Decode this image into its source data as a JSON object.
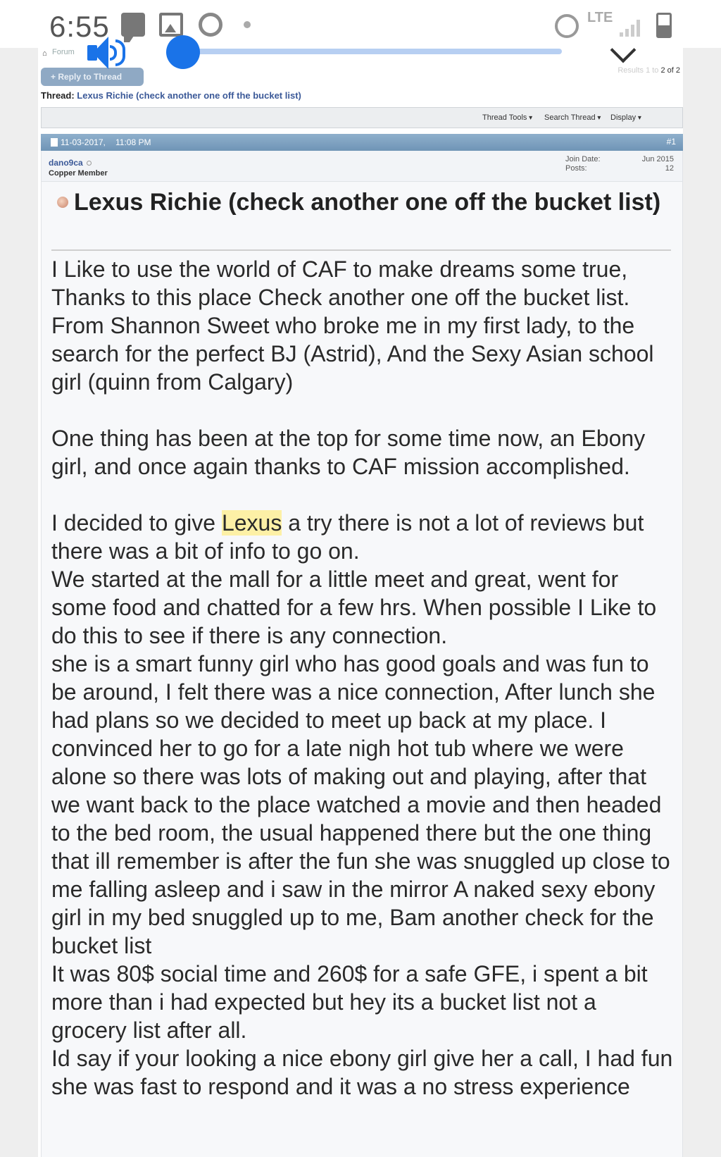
{
  "status_bar": {
    "time": "6:55",
    "network": "LTE"
  },
  "forum": {
    "breadcrumb": "Forum",
    "reply_button": "+ Reply to Thread",
    "results_prefix": "Results 1 to ",
    "results_suffix": "2 of 2",
    "thread_label": "Thread:",
    "thread_title": "Lexus Richie (check another one off the bucket list)",
    "tools": [
      "Thread Tools",
      "Search Thread",
      "Display"
    ]
  },
  "post": {
    "date": "11-03-2017,",
    "time": "11:08 PM",
    "number": "#1",
    "username": "dano9ca",
    "user_title": "Copper Member",
    "join_date_label": "Join Date:",
    "join_date": "Jun 2015",
    "posts_label": "Posts:",
    "posts": "12",
    "title": "Lexus Richie (check another one off the bucket list)",
    "p1": "I Like to use the world of CAF to make dreams some true, Thanks to this place Check another one off the bucket list. From Shannon Sweet who broke me in my first lady, to the search for the perfect BJ (Astrid), And the Sexy Asian school girl (quinn from Calgary)",
    "p2": "One thing has been at the top for some time now, an Ebony girl, and once again thanks to CAF mission accomplished.",
    "p3_before": "I decided to give ",
    "p3_highlight": "Lexus",
    "p3_after": " a try there is not a lot of reviews but there was a bit of info to go on.\nWe started at the mall for a little meet and great, went for some food and chatted for a few hrs. When possible I Like to do this to see if there is any connection.\nshe is a smart funny girl who has good goals and was fun to be around, I felt there was a nice connection, After lunch she had plans so we decided to meet up back at my place. I convinced her to go for a late nigh hot tub where we were alone so there was lots of making out and playing, after that we want back to the place watched a movie and then headed to the bed room, the usual happened there but the one thing that ill remember is after the fun she was snuggled up close to me falling asleep and i saw in the mirror A naked sexy ebony girl in my bed snuggled up to me, Bam another check for the bucket list\nIt was 80$ social time and 260$ for a safe GFE, i spent a bit more than i had expected but hey its a bucket list not a grocery list after all.\nId say if your looking a nice ebony girl give her a call, I had fun she was fast to respond and it was a no stress experience"
  },
  "media_overlay": {
    "volume_level": 0.04,
    "accent": "#1a73e8"
  }
}
